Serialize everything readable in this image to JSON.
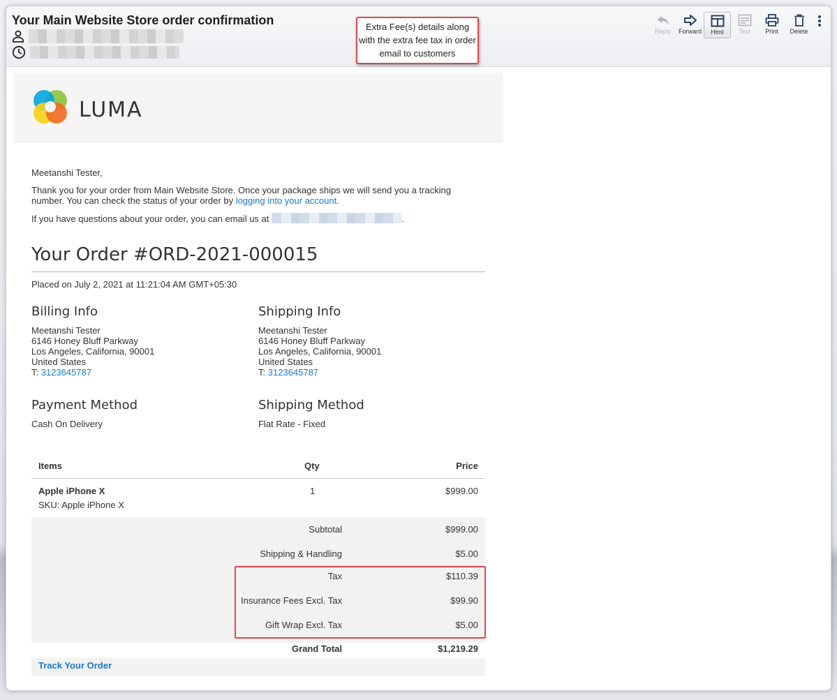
{
  "email": {
    "subject": "Your Main Website Store order confirmation"
  },
  "annotation": "Extra Fee(s) details along with the extra fee tax in order email to customers",
  "toolbar": {
    "reply": "Reply",
    "forward": "Forward",
    "html": "Html",
    "text": "Text",
    "print": "Print",
    "delete": "Delete"
  },
  "brand": {
    "name": "LUMA"
  },
  "message": {
    "greeting": "Meetanshi Tester,",
    "thanks_line1": "Thank you for your order from Main Website Store. Once your package ships we will send you a tracking",
    "thanks_line2_prefix": "number. You can check the status of your order by ",
    "account_link": "logging into your account",
    "thanks_line2_suffix": ".",
    "questions_prefix": "If you have questions about your order, you can email us at",
    "questions_suffix": "."
  },
  "order": {
    "title": "Your Order #ORD-2021-000015",
    "placed": "Placed on July 2, 2021 at 11:21:04 AM GMT+05:30",
    "billing": {
      "heading": "Billing Info",
      "name": "Meetanshi Tester",
      "street": "6146 Honey Bluff Parkway",
      "city": "Los Angeles, California, 90001",
      "country": "United States",
      "phone_label": "T: ",
      "phone": "3123645787"
    },
    "shipping": {
      "heading": "Shipping Info",
      "name": "Meetanshi Tester",
      "street": "6146 Honey Bluff Parkway",
      "city": "Los Angeles, California, 90001",
      "country": "United States",
      "phone_label": "T: ",
      "phone": "3123645787"
    },
    "payment": {
      "heading": "Payment Method",
      "value": "Cash On Delivery"
    },
    "shipping_method": {
      "heading": "Shipping Method",
      "value": "Flat Rate - Fixed"
    },
    "table": {
      "headers": {
        "items": "Items",
        "qty": "Qty",
        "price": "Price"
      },
      "items": [
        {
          "name": "Apple iPhone X",
          "sku": "SKU: Apple iPhone X",
          "qty": "1",
          "price": "$999.00"
        }
      ],
      "totals": [
        {
          "label": "Subtotal",
          "value": "$999.00"
        },
        {
          "label": "Shipping & Handling",
          "value": "$5.00"
        },
        {
          "label": "Tax",
          "value": "$110.39"
        },
        {
          "label": "Insurance Fees Excl. Tax",
          "value": "$99.90"
        },
        {
          "label": "Gift Wrap Excl. Tax",
          "value": "$5.00"
        }
      ],
      "grand_total": {
        "label": "Grand Total",
        "value": "$1,219.29"
      }
    },
    "track_link": "Track Your Order"
  },
  "colors": {
    "link": "#1979c3",
    "highlight": "#e0474c"
  }
}
